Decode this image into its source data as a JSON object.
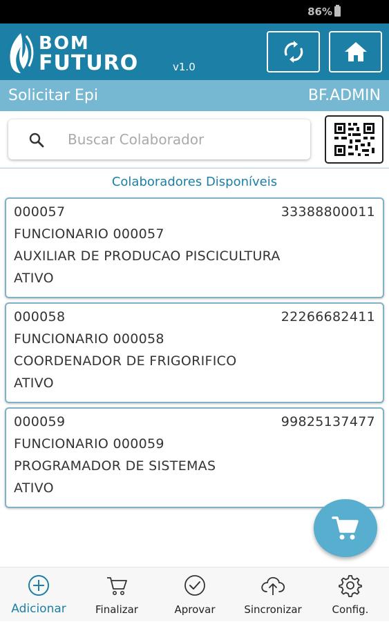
{
  "status_bar": {
    "battery": "86%"
  },
  "header": {
    "logo_line1": "BOM",
    "logo_line2": "FUTURO",
    "version": "v1.0",
    "sync_button": "sync-icon",
    "home_button": "home-icon"
  },
  "sub_header": {
    "title": "Solicitar Epi",
    "user": "BF.ADMIN"
  },
  "search": {
    "placeholder": "Buscar Colaborador",
    "value": ""
  },
  "list": {
    "title": "Colaboradores Disponíveis",
    "items": [
      {
        "code": "000057",
        "phone": "33388800011",
        "name": "FUNCIONARIO 000057",
        "role": "AUXILIAR DE PRODUCAO PISCICULTURA",
        "status": "ATIVO"
      },
      {
        "code": "000058",
        "phone": "22266682411",
        "name": "FUNCIONARIO 000058",
        "role": "COORDENADOR DE FRIGORIFICO",
        "status": "ATIVO"
      },
      {
        "code": "000059",
        "phone": "99825137477",
        "name": "FUNCIONARIO 000059",
        "role": "PROGRAMADOR DE SISTEMAS",
        "status": "ATIVO"
      }
    ]
  },
  "nav": {
    "items": [
      {
        "label": "Adicionar",
        "icon": "add-circle-icon"
      },
      {
        "label": "Finalizar",
        "icon": "cart-icon"
      },
      {
        "label": "Aprovar",
        "icon": "check-circle-icon"
      },
      {
        "label": "Sincronizar",
        "icon": "cloud-upload-icon"
      },
      {
        "label": "Config.",
        "icon": "gear-icon"
      }
    ]
  },
  "colors": {
    "primary": "#1b7fa6",
    "sub_header": "#76b8d1",
    "fab": "#58aecf",
    "card_border": "#7fb2c6"
  }
}
